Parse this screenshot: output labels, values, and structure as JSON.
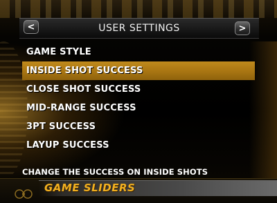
{
  "header": {
    "title": "USER SETTINGS",
    "prev_label": "<",
    "next_label": ">"
  },
  "menu": {
    "items": [
      {
        "label": "GAME STYLE",
        "selected": false
      },
      {
        "label": "INSIDE SHOT SUCCESS",
        "selected": true
      },
      {
        "label": "CLOSE SHOT SUCCESS",
        "selected": false
      },
      {
        "label": "MID-RANGE SUCCESS",
        "selected": false
      },
      {
        "label": "3PT SUCCESS",
        "selected": false
      },
      {
        "label": "LAYUP SUCCESS",
        "selected": false
      }
    ]
  },
  "description": "CHANGE THE SUCCESS ON INSIDE SHOTS",
  "footer": {
    "title": "GAME SLIDERS",
    "logo_icon": "2k-logo-icon"
  },
  "colors": {
    "accent": "#b07a14",
    "footer_title": "#f2b020",
    "background": "#000000"
  }
}
